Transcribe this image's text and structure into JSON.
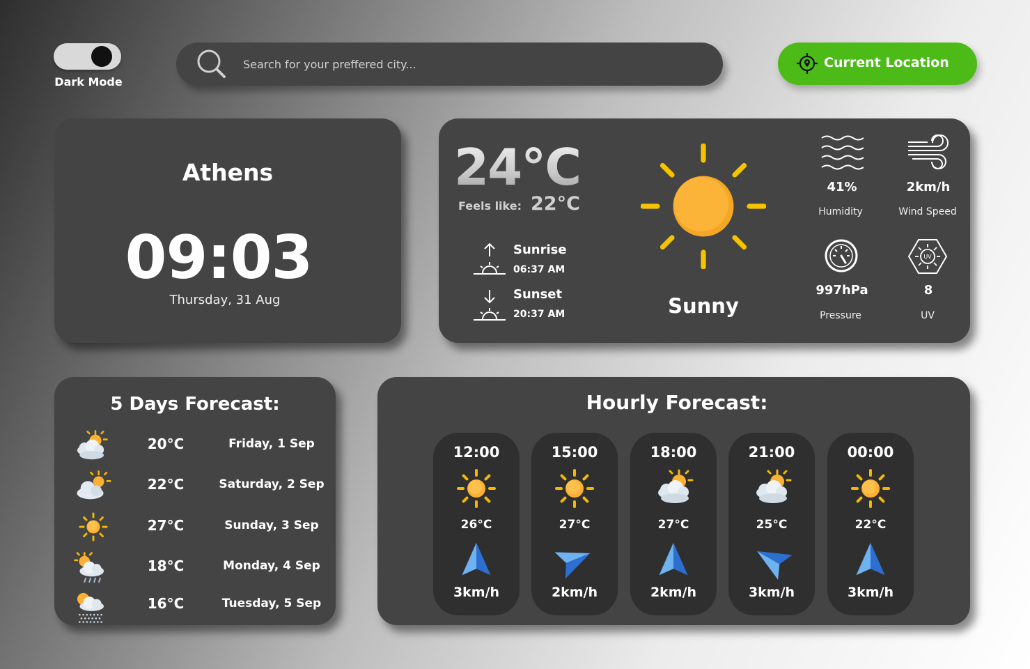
{
  "dark_mode": {
    "label": "Dark Mode",
    "enabled": true
  },
  "search": {
    "placeholder": "Search for your preffered city..."
  },
  "location_button": {
    "label": "Current Location",
    "color": "#4cbb17"
  },
  "city": {
    "name": "Athens",
    "time": "09:03",
    "date": "Thursday, 31 Aug"
  },
  "current": {
    "temperature": "24°C",
    "feels_like_label": "Feels like:",
    "feels_like": "22°C",
    "sunrise_label": "Sunrise",
    "sunrise": "06:37 AM",
    "sunset_label": "Sunset",
    "sunset": "20:37 AM",
    "condition": "Sunny",
    "condition_icon": "sun-icon",
    "humidity": "41%",
    "humidity_label": "Humidity",
    "wind_speed": "2km/h",
    "wind_speed_label": "Wind Speed",
    "pressure": "997hPa",
    "pressure_label": "Pressure",
    "uv": "8",
    "uv_label": "UV"
  },
  "five_day": {
    "title": "5 Days Forecast:",
    "days": [
      {
        "icon": "partly-cloudy-icon",
        "temp": "20°C",
        "day": "Friday, 1 Sep"
      },
      {
        "icon": "cloud-sun-icon",
        "temp": "22°C",
        "day": "Saturday, 2 Sep"
      },
      {
        "icon": "sun-icon",
        "temp": "27°C",
        "day": "Sunday, 3 Sep"
      },
      {
        "icon": "rain-icon",
        "temp": "18°C",
        "day": "Monday, 4 Sep"
      },
      {
        "icon": "drizzle-icon",
        "temp": "16°C",
        "day": "Tuesday, 5 Sep"
      }
    ]
  },
  "hourly": {
    "title": "Hourly Forecast:",
    "hours": [
      {
        "time": "12:00",
        "icon": "sun-icon",
        "temp": "26°C",
        "wind_icon": "navigation-north-icon",
        "wind": "3km/h"
      },
      {
        "time": "15:00",
        "icon": "sun-icon",
        "temp": "27°C",
        "wind_icon": "navigation-east-icon",
        "wind": "2km/h"
      },
      {
        "time": "18:00",
        "icon": "partly-cloudy-icon",
        "temp": "27°C",
        "wind_icon": "navigation-north-icon",
        "wind": "2km/h"
      },
      {
        "time": "21:00",
        "icon": "partly-cloudy-icon",
        "temp": "25°C",
        "wind_icon": "navigation-west-icon",
        "wind": "3km/h"
      },
      {
        "time": "00:00",
        "icon": "sun-icon",
        "temp": "22°C",
        "wind_icon": "navigation-north-icon",
        "wind": "3km/h"
      }
    ]
  },
  "colors": {
    "card": "#444444",
    "hour_card": "#2f2f2f",
    "sun": "#fbb034",
    "accent_green": "#4cbb17",
    "arrow_blue": "#4a90e2"
  }
}
